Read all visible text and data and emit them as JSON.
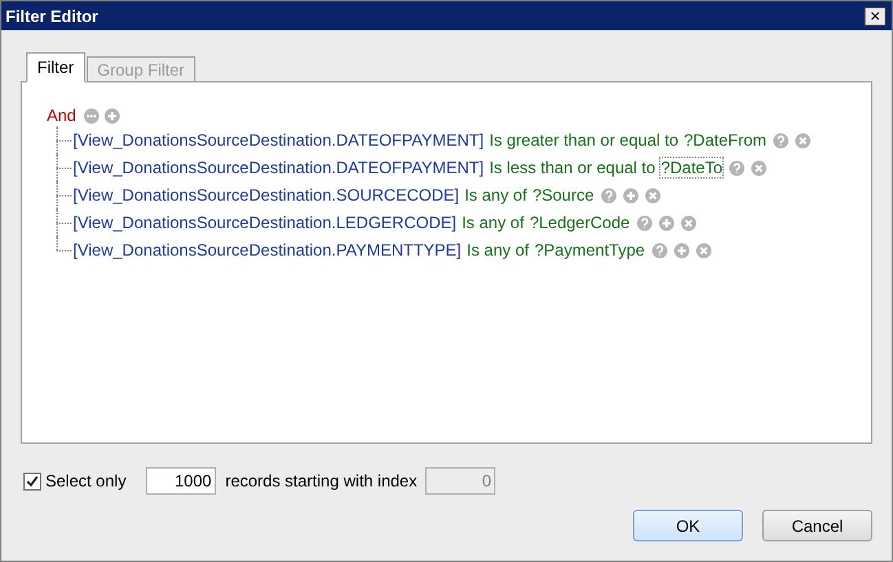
{
  "window": {
    "title": "Filter Editor",
    "close": "×"
  },
  "tabs": [
    {
      "label": "Filter",
      "selected": true,
      "disabled": false
    },
    {
      "label": "Group Filter",
      "selected": false,
      "disabled": true
    }
  ],
  "group": {
    "operator": "And"
  },
  "conditions": [
    {
      "field": "[View_DonationsSourceDestination.DATEOFPAYMENT]",
      "operator": "Is greater than or equal to",
      "value": "?DateFrom",
      "kind": "single",
      "focused": false
    },
    {
      "field": "[View_DonationsSourceDestination.DATEOFPAYMENT]",
      "operator": "Is less than or equal to",
      "value": "?DateTo",
      "kind": "single",
      "focused": true
    },
    {
      "field": "[View_DonationsSourceDestination.SOURCECODE]",
      "operator": "Is any of",
      "value": "?Source",
      "kind": "list",
      "focused": false
    },
    {
      "field": "[View_DonationsSourceDestination.LEDGERCODE]",
      "operator": "Is any of",
      "value": "?LedgerCode",
      "kind": "list",
      "focused": false
    },
    {
      "field": "[View_DonationsSourceDestination.PAYMENTTYPE]",
      "operator": "Is any of",
      "value": "?PaymentType",
      "kind": "list",
      "focused": false
    }
  ],
  "select_only": {
    "label": "Select only",
    "checked": true,
    "count": "1000",
    "middle_label": "records starting with index",
    "index": "0",
    "index_disabled": true
  },
  "buttons": [
    {
      "label": "OK",
      "default": true
    },
    {
      "label": "Cancel",
      "default": false
    }
  ]
}
